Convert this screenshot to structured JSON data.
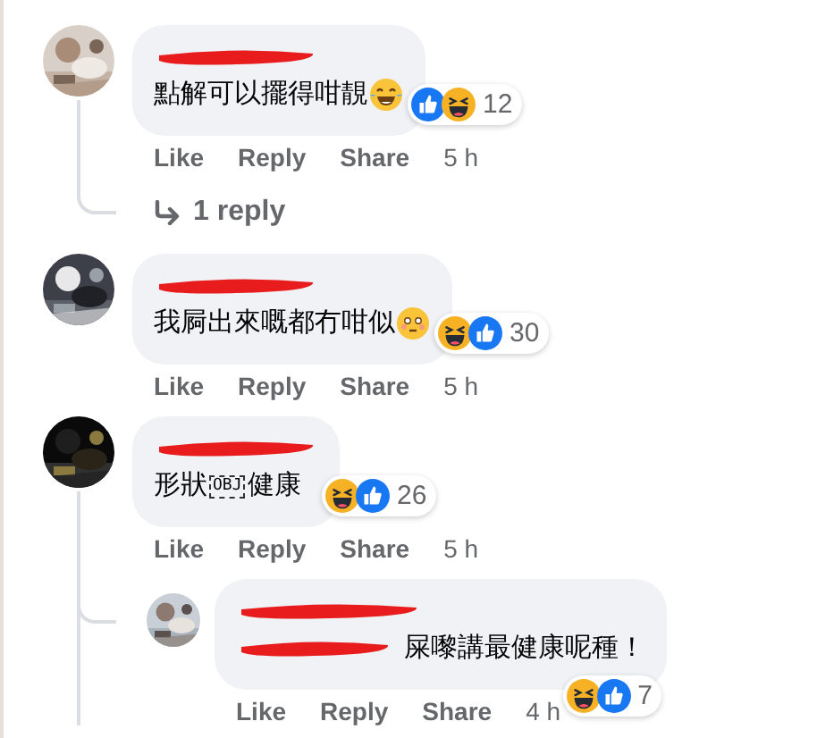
{
  "comments": [
    {
      "avatar": {
        "kind": "picture"
      },
      "author_redacted": true,
      "segments": [
        {
          "kind": "text",
          "text": "點解可以擺得咁靚"
        },
        {
          "kind": "tears-emoji"
        }
      ],
      "reactions": [
        {
          "kind": "like"
        },
        {
          "kind": "haha"
        }
      ],
      "reaction_count": "12",
      "actions": [
        "Like",
        "Reply",
        "Share"
      ],
      "time": "5 h",
      "replies_link": {
        "label": "1 reply"
      }
    },
    {
      "avatar": {
        "kind": "picture"
      },
      "author_redacted": true,
      "segments": [
        {
          "kind": "text",
          "text": "我屙出來嘅都冇咁似"
        },
        {
          "kind": "uneasy-emoji"
        }
      ],
      "reactions": [
        {
          "kind": "haha"
        },
        {
          "kind": "like"
        }
      ],
      "reaction_count": "30",
      "actions": [
        "Like",
        "Reply",
        "Share"
      ],
      "time": "5 h"
    },
    {
      "avatar": {
        "kind": "picture"
      },
      "author_redacted": true,
      "segments": [
        {
          "kind": "text",
          "text": "形狀"
        },
        {
          "kind": "object",
          "text": "OBJ"
        },
        {
          "kind": "text",
          "text": "健康"
        }
      ],
      "reactions": [
        {
          "kind": "haha"
        },
        {
          "kind": "like"
        }
      ],
      "reaction_count": "26",
      "actions": [
        "Like",
        "Reply",
        "Share"
      ],
      "time": "5 h",
      "replies": [
        {
          "avatar": {
            "kind": "picture"
          },
          "author_redacted": true,
          "segments": [
            {
              "kind": "mention",
              "redacted": true
            },
            {
              "kind": "text",
              "text": "屎嚟講最健康呢種！"
            }
          ],
          "reactions": [
            {
              "kind": "haha"
            },
            {
              "kind": "like"
            }
          ],
          "reaction_count": "7",
          "actions": [
            "Like",
            "Reply",
            "Share"
          ],
          "time": "4 h"
        }
      ]
    }
  ]
}
